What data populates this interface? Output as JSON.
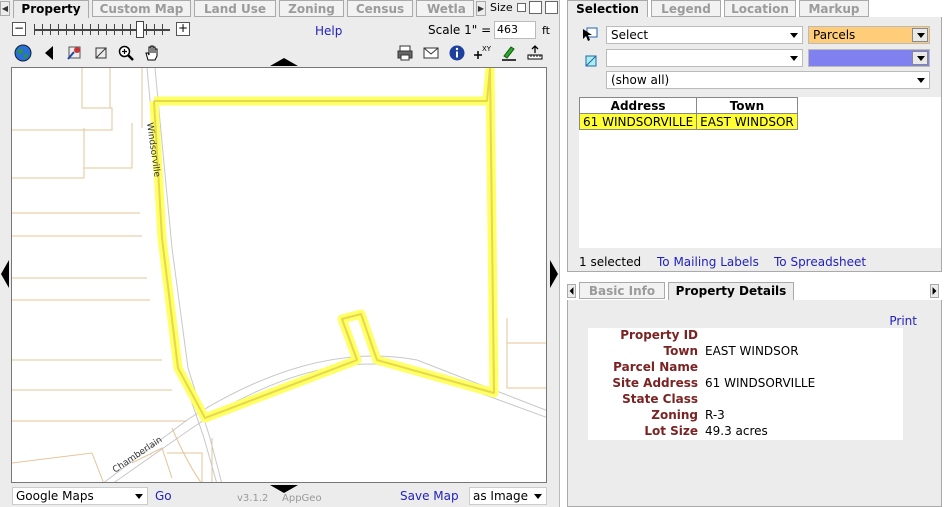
{
  "left_tabs": [
    "Property",
    "Custom Map",
    "Land Use",
    "Zoning",
    "Census",
    "Wetla"
  ],
  "size_label": "Size",
  "zoom": {
    "level": 0.78
  },
  "help_label": "Help",
  "scale": {
    "label": "Scale 1\" =",
    "value": "463",
    "unit": "ft"
  },
  "map": {
    "streets": [
      "Windsorville",
      "Chamberlain"
    ]
  },
  "bottom": {
    "basemap": "Google Maps",
    "go": "Go",
    "version": "v3.1.2",
    "vendor": "AppGeo",
    "save_map": "Save Map",
    "save_format": "as Image"
  },
  "right_tabs": [
    "Selection",
    "Legend",
    "Location",
    "Markup"
  ],
  "selection": {
    "action": "Select",
    "layer": "Parcels",
    "layer_color": "#ffcc7a",
    "second_layer_color": "#8080ee",
    "filter": "(show all)",
    "columns": [
      "Address",
      "Town"
    ],
    "rows": [
      [
        "61 WINDSORVILLE",
        "EAST WINDSOR"
      ]
    ],
    "count": "1 selected",
    "mail_link": "To Mailing Labels",
    "sheet_link": "To Spreadsheet"
  },
  "detail_tabs": [
    "Basic Info",
    "Property Details"
  ],
  "details": {
    "print": "Print",
    "fields": [
      {
        "label": "Property ID",
        "value": ""
      },
      {
        "label": "Town",
        "value": "EAST WINDSOR"
      },
      {
        "label": "Parcel Name",
        "value": ""
      },
      {
        "label": "Site Address",
        "value": "61 WINDSORVILLE"
      },
      {
        "label": "State Class",
        "value": ""
      },
      {
        "label": "Zoning",
        "value": "R-3"
      },
      {
        "label": "Lot Size",
        "value": "49.3 acres"
      }
    ]
  }
}
